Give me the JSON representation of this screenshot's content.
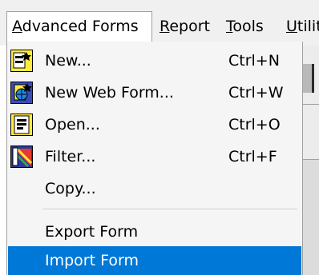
{
  "menubar": {
    "items": [
      {
        "label": "Advanced Forms",
        "mnemonic": "A",
        "rest": "dvanced Forms",
        "active": true
      },
      {
        "label": "Report",
        "mnemonic": "R",
        "rest": "eport",
        "active": false
      },
      {
        "label": "Tools",
        "mnemonic": "T",
        "rest": "ools",
        "active": false
      },
      {
        "label": "Utilit",
        "mnemonic": "U",
        "rest": "tilit",
        "active": false
      }
    ]
  },
  "dropdown": {
    "items": [
      {
        "label": "New...",
        "shortcut": "Ctrl+N",
        "icon": "new-form-icon"
      },
      {
        "label": "New Web Form...",
        "shortcut": "Ctrl+W",
        "icon": "new-web-form-icon"
      },
      {
        "label": "Open...",
        "shortcut": "Ctrl+O",
        "icon": "open-form-icon"
      },
      {
        "label": "Filter...",
        "shortcut": "Ctrl+F",
        "icon": "filter-icon"
      },
      {
        "label": "Copy...",
        "shortcut": "",
        "icon": ""
      },
      {
        "label": "Export Form",
        "shortcut": "",
        "icon": ""
      },
      {
        "label": "Import Form",
        "shortcut": "",
        "icon": "",
        "highlighted": true
      }
    ]
  },
  "colors": {
    "highlight": "#0078d7",
    "menu_background": "#f5f5f5",
    "menubar_background": "#f0f0f0"
  }
}
